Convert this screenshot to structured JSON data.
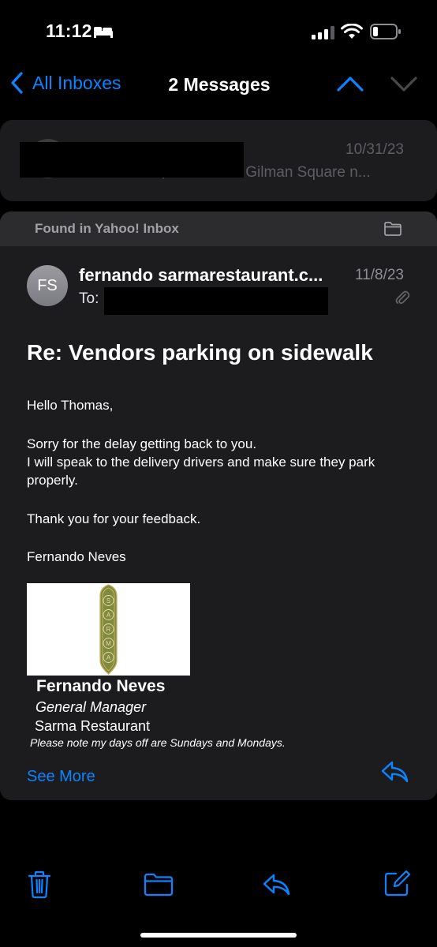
{
  "status_bar": {
    "time": "11:12"
  },
  "nav": {
    "back_label": "All Inboxes",
    "title": "2 Messages"
  },
  "previous_message": {
    "date": "10/31/23",
    "preview": "Hi Fernando, I live in the Gilman Square n..."
  },
  "message": {
    "found_in": "Found in Yahoo! Inbox",
    "avatar_initials": "FS",
    "sender": "fernando sarmarestaurant.c...",
    "date": "11/8/23",
    "to_label": "To:",
    "subject": "Re: Vendors parking on sidewalk",
    "greeting": "Hello Thomas,",
    "body_line1": "Sorry for the delay getting back to you.",
    "body_line2": "I will speak to the delivery drivers and make sure they park properly.",
    "thanks": "Thank you for your feedback.",
    "closing_name": "Fernando Neves",
    "signature": {
      "logo_letters": [
        "S",
        "A",
        "R",
        "M",
        "A"
      ],
      "name": "Fernando Neves",
      "title": "General Manager",
      "company": "Sarma Restaurant",
      "note": "Please note my days off are Sundays and Mondays."
    },
    "see_more": "See More"
  },
  "toolbar": {
    "icons": [
      "trash-icon",
      "folder-icon",
      "reply-icon",
      "compose-icon"
    ]
  },
  "colors": {
    "accent": "#0a84ff",
    "card": "#1c1c1e",
    "background": "#000000"
  }
}
